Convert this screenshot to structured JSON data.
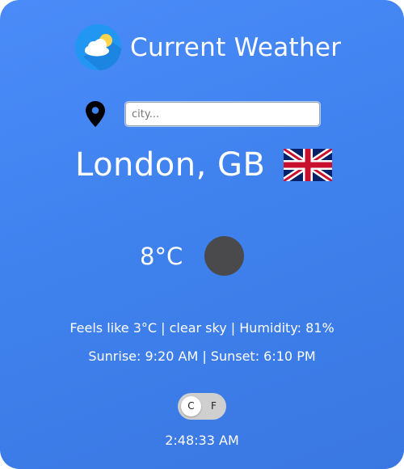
{
  "app": {
    "title": "Current Weather",
    "logo_icon": "partly-cloudy-icon"
  },
  "search": {
    "placeholder": "city...",
    "value": "",
    "location_icon": "map-pin-icon"
  },
  "location": {
    "name": "London, GB",
    "flag_icon": "uk-flag-icon"
  },
  "current": {
    "temperature": "8°C",
    "condition_icon": "weather-condition-icon",
    "feels_line": "Feels like 3°C | clear sky | Humidity: 81%",
    "sun_line": "Sunrise: 9:20 AM | Sunset: 6:10 PM"
  },
  "units": {
    "celsius_label": "C",
    "fahrenheit_label": "F",
    "selected": "C"
  },
  "clock": {
    "time": "2:48:33 AM"
  },
  "colors": {
    "background_top": "#4a8bf8",
    "background_bottom": "#3a77e2",
    "text": "#ffffff",
    "toggle_track": "#cfcfcf",
    "condition_icon": "#4a4a4c"
  }
}
